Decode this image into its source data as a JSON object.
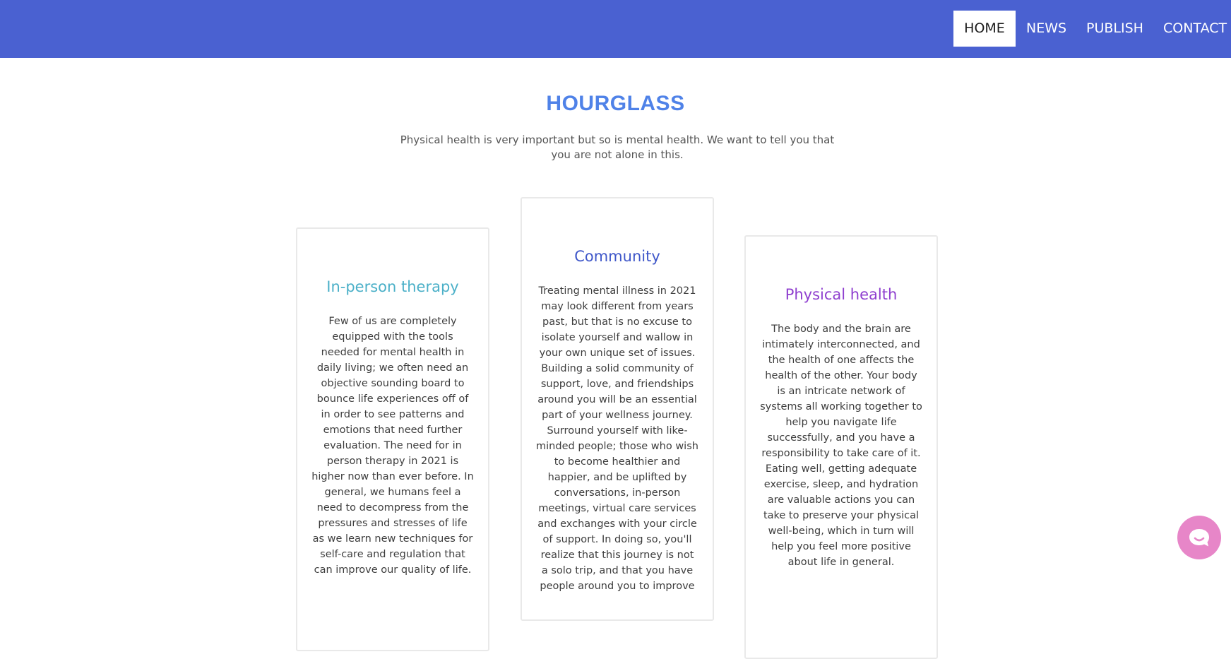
{
  "nav": {
    "items": [
      {
        "label": "HOME",
        "active": true
      },
      {
        "label": "NEWS"
      },
      {
        "label": "PUBLISH"
      },
      {
        "label": "CONTACT"
      }
    ]
  },
  "hero": {
    "title": "HOURGLASS",
    "subtitle": "Physical health is very important but so is mental health. We want to tell you that you are not alone in this."
  },
  "cards": [
    {
      "title": "In-person therapy",
      "title_color": "#4bb0c8",
      "body": "Few of us are completely equipped with the tools needed for mental health in daily living; we often need an objective sounding board to bounce life experiences off of in order to see patterns and emotions that need further evaluation. The need for in person therapy in 2021 is higher now than ever before. In general, we humans feel a need to decompress from the pressures and stresses of life as we learn new techniques for self-care and regulation that can improve our quality of life."
    },
    {
      "title": "Community",
      "title_color": "#3f57c9",
      "body": "Treating mental illness in 2021 may look different from years past, but that is no excuse to isolate yourself and wallow in your own unique set of issues. Building a solid community of support, love, and friendships around you will be an essential part of your wellness journey. Surround yourself with like-minded people; those who wish to become healthier and happier, and be uplifted by conversations, in-person meetings, virtual care services and exchanges with your circle of support. In doing so, you'll realize that this journey is not a solo trip, and that you have people around you to improve"
    },
    {
      "title": "Physical health",
      "title_color": "#8f3fcf",
      "body": "The body and the brain are intimately interconnected, and the health of one affects the health of the other. Your body is an intricate network of systems all working together to help you navigate life successfully, and you have a responsibility to take care of it. Eating well, getting adequate exercise, sleep, and hydration are valuable actions you can take to preserve your physical well-being, which in turn will help you feel more positive about life in general."
    }
  ],
  "colors": {
    "navbar": "#4a61d1",
    "hero_title": "#4f82e8",
    "chat_widget": "#e786c8"
  },
  "chat_widget": {
    "icon": "chat-bubble-icon"
  }
}
